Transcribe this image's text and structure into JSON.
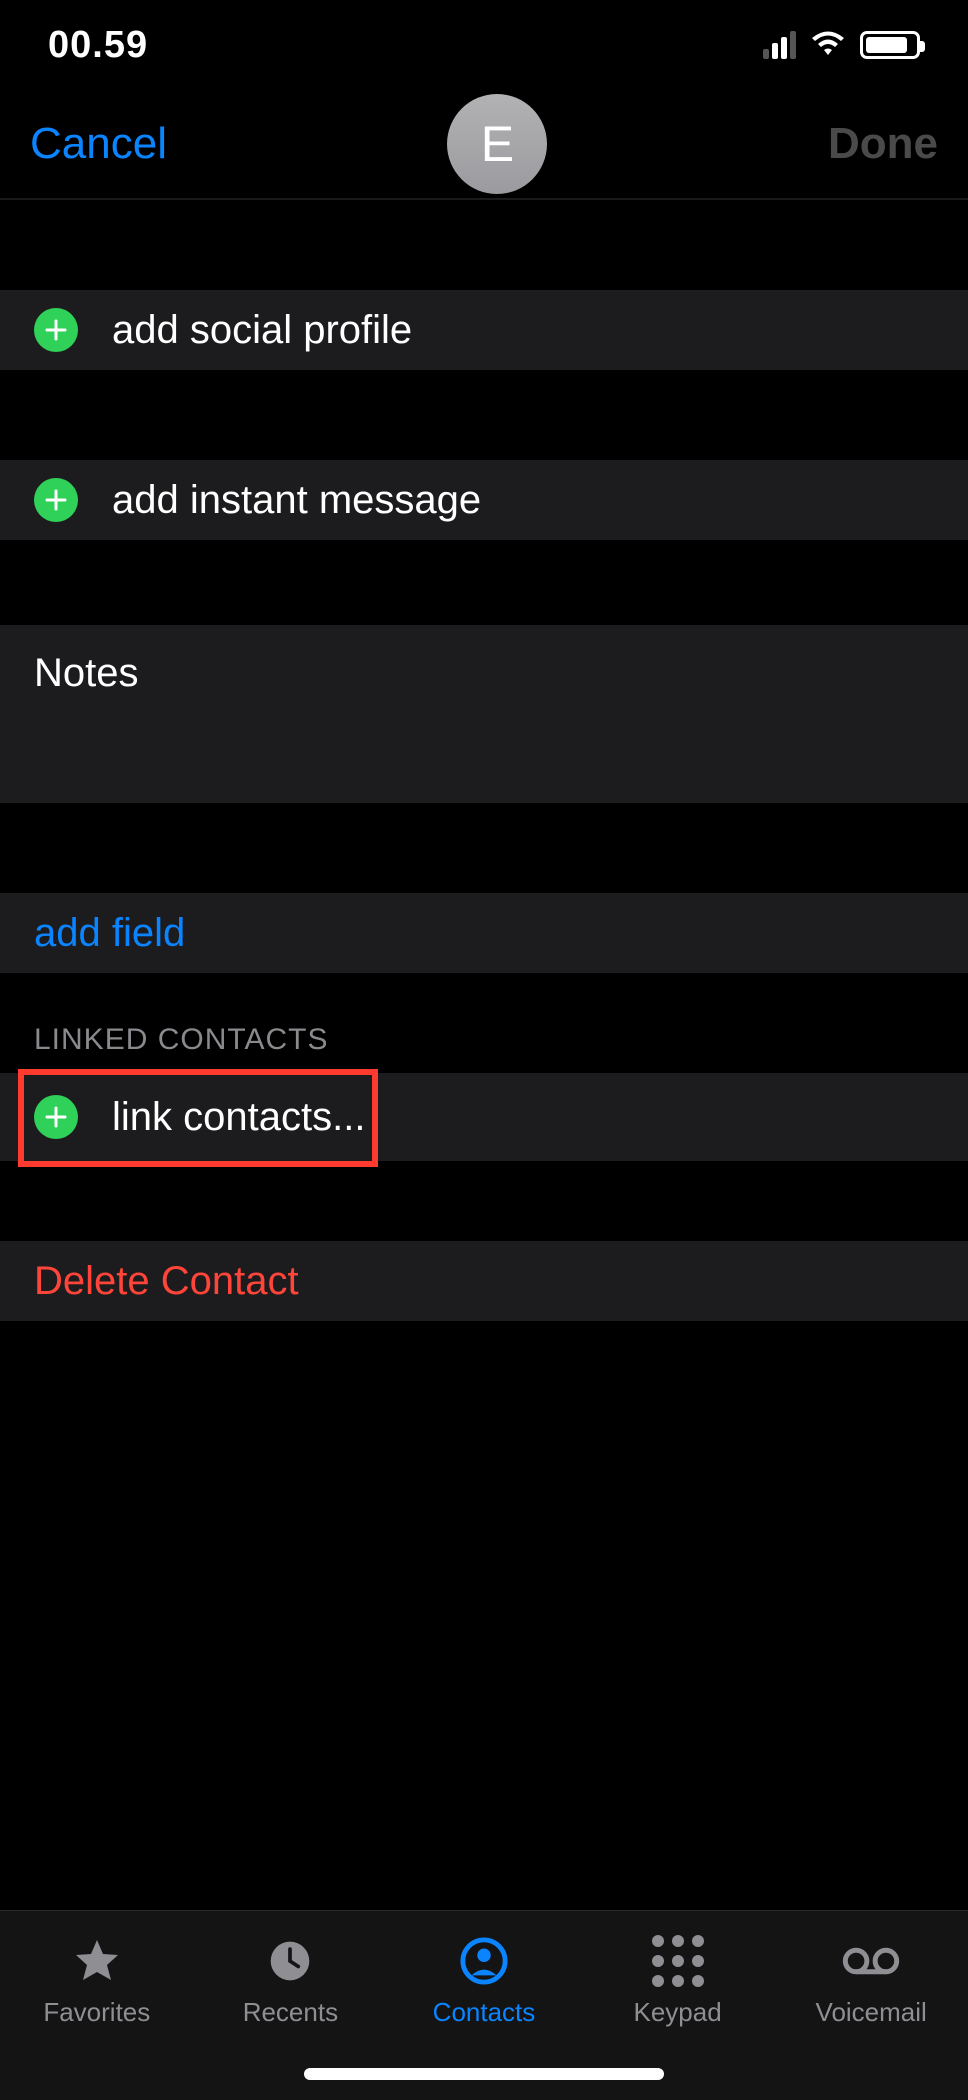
{
  "status": {
    "time": "00.59"
  },
  "header": {
    "cancel": "Cancel",
    "done": "Done",
    "avatar_initial": "E"
  },
  "rows": {
    "add_social": "add social profile",
    "add_im": "add instant message",
    "notes_label": "Notes",
    "add_field": "add field",
    "linked_section": "LINKED CONTACTS",
    "link_contacts": "link contacts...",
    "delete": "Delete Contact"
  },
  "tabs": {
    "favorites": "Favorites",
    "recents": "Recents",
    "contacts": "Contacts",
    "keypad": "Keypad",
    "voicemail": "Voicemail"
  },
  "colors": {
    "accent": "#0a84ff",
    "green": "#30d158",
    "red": "#ff453a",
    "row_bg": "#1c1c1e"
  }
}
